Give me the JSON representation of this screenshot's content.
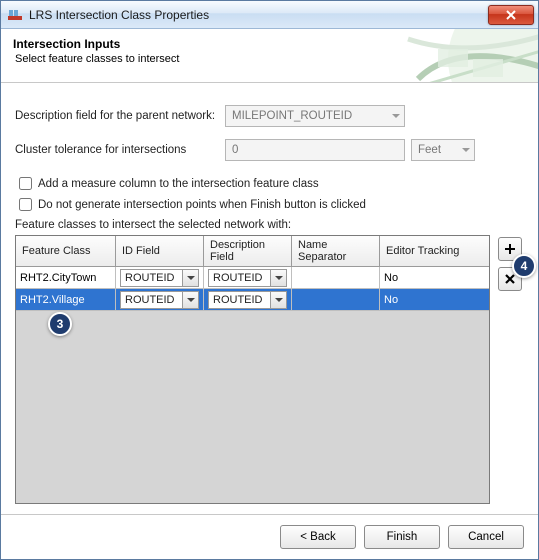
{
  "window": {
    "title": "LRS Intersection Class Properties"
  },
  "banner": {
    "title": "Intersection Inputs",
    "subtitle": "Select feature classes to intersect"
  },
  "form": {
    "desc_label": "Description field for the parent network:",
    "desc_value": "MILEPOINT_ROUTEID",
    "cluster_label": "Cluster tolerance for intersections",
    "cluster_value": "0",
    "cluster_unit": "Feet",
    "check_measure": "Add a measure column to the intersection feature class",
    "check_nogen": "Do not generate intersection points when Finish button is clicked",
    "grid_label": "Feature classes to intersect the selected network with:"
  },
  "grid": {
    "columns": {
      "fc": "Feature Class",
      "id": "ID Field",
      "de": "Description Field",
      "ns": "Name Separator",
      "et": "Editor Tracking"
    },
    "rows": [
      {
        "fc": "RHT2.CityTown",
        "id": "ROUTEID",
        "de": "ROUTEID",
        "ns": "",
        "et": "No",
        "selected": false
      },
      {
        "fc": "RHT2.Village",
        "id": "ROUTEID",
        "de": "ROUTEID",
        "ns": "",
        "et": "No",
        "selected": true
      }
    ]
  },
  "buttons": {
    "add_tooltip": "Add",
    "remove_tooltip": "Remove",
    "back": "< Back",
    "finish": "Finish",
    "cancel": "Cancel"
  },
  "callouts": {
    "c3": "3",
    "c4": "4"
  }
}
